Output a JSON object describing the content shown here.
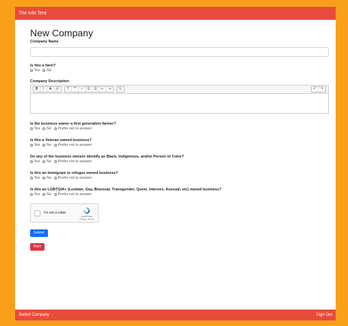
{
  "app": {
    "title": "The Info Tent"
  },
  "page": {
    "title": "New Company"
  },
  "form": {
    "company_name_label": "Company Name",
    "company_name_value": "",
    "farm": {
      "label": "Is this a farm?",
      "options": [
        "Yes",
        "No"
      ]
    },
    "description": {
      "label": "Company Description",
      "toolbar": [
        [
          "B",
          "I",
          "S",
          "🔗"
        ],
        [
          "T",
          "❞",
          "‹›",
          "☰",
          "☰",
          "⇤",
          "⇥"
        ],
        [
          "📎"
        ]
      ],
      "toolbar_right": [
        "↶",
        "↷"
      ],
      "value": ""
    },
    "questions": [
      {
        "label": "Is the business owner a first generation farmer?",
        "options": [
          "Yes",
          "No",
          "Prefer not to answer"
        ]
      },
      {
        "label": "Is this a Veteran owned business?",
        "options": [
          "Yes",
          "No",
          "Prefer not to answer"
        ]
      },
      {
        "label": "Do any of the business owners identify as Black, Indigenous, and/or Person of Color?",
        "options": [
          "Yes",
          "No",
          "Prefer not to answer"
        ]
      },
      {
        "label": "Is this an immigrant or refugee owned business?",
        "options": [
          "Yes",
          "No",
          "Prefer not to answer"
        ]
      },
      {
        "label": "Is this an LGBTQIA+ (Lesbian, Gay, Bisexual, Transgender, Queer, Intersex, Asexual, etc) owned business?",
        "options": [
          "Yes",
          "No",
          "Prefer not to answer"
        ]
      }
    ],
    "captcha": {
      "label": "I'm not a robot",
      "brand": "reCAPTCHA",
      "links": "Privacy - Terms"
    },
    "submit_label": "Submit",
    "back_label": "Back"
  },
  "footer": {
    "left": "Switch Company",
    "right": "Sign Out"
  },
  "colors": {
    "frame": "#f8a01c",
    "bar": "#e74c3c",
    "submit": "#0d6efd",
    "back": "#dc3545"
  }
}
